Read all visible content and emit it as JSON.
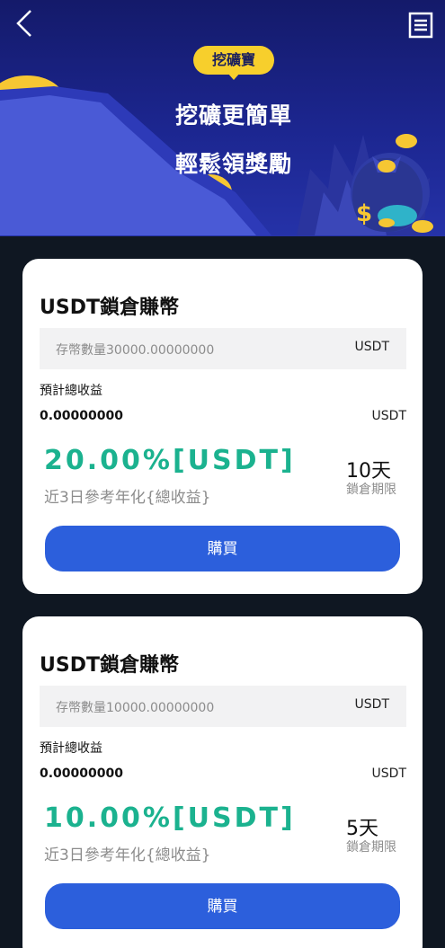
{
  "header": {
    "badge": "挖礦寶",
    "headline_1": "挖礦更簡單",
    "headline_2": "輕鬆領獎勵",
    "back_icon": "chevron-left-icon",
    "menu_icon": "document-list-icon"
  },
  "colors": {
    "hero_bg": "#1c2690",
    "page_bg": "#0f1722",
    "accent_green": "#1bb28f",
    "button_blue": "#2c5fdc",
    "badge_yellow": "#f7cf2c"
  },
  "products": [
    {
      "title": "USDT鎖倉賺幣",
      "amount_placeholder": "存幣數量30000.00000000",
      "amount_unit": "USDT",
      "est_label": "預計總收益",
      "est_value": "0.00000000",
      "est_unit": "USDT",
      "rate": "20.00%[USDT]",
      "rate_desc": "近3日參考年化{總收益}",
      "days": "10天",
      "days_desc": "鎖倉期限",
      "button": "購買"
    },
    {
      "title": "USDT鎖倉賺幣",
      "amount_placeholder": "存幣數量10000.00000000",
      "amount_unit": "USDT",
      "est_label": "預計總收益",
      "est_value": "0.00000000",
      "est_unit": "USDT",
      "rate": "10.00%[USDT]",
      "rate_desc": "近3日參考年化{總收益}",
      "days": "5天",
      "days_desc": "鎖倉期限",
      "button": "購買"
    }
  ]
}
